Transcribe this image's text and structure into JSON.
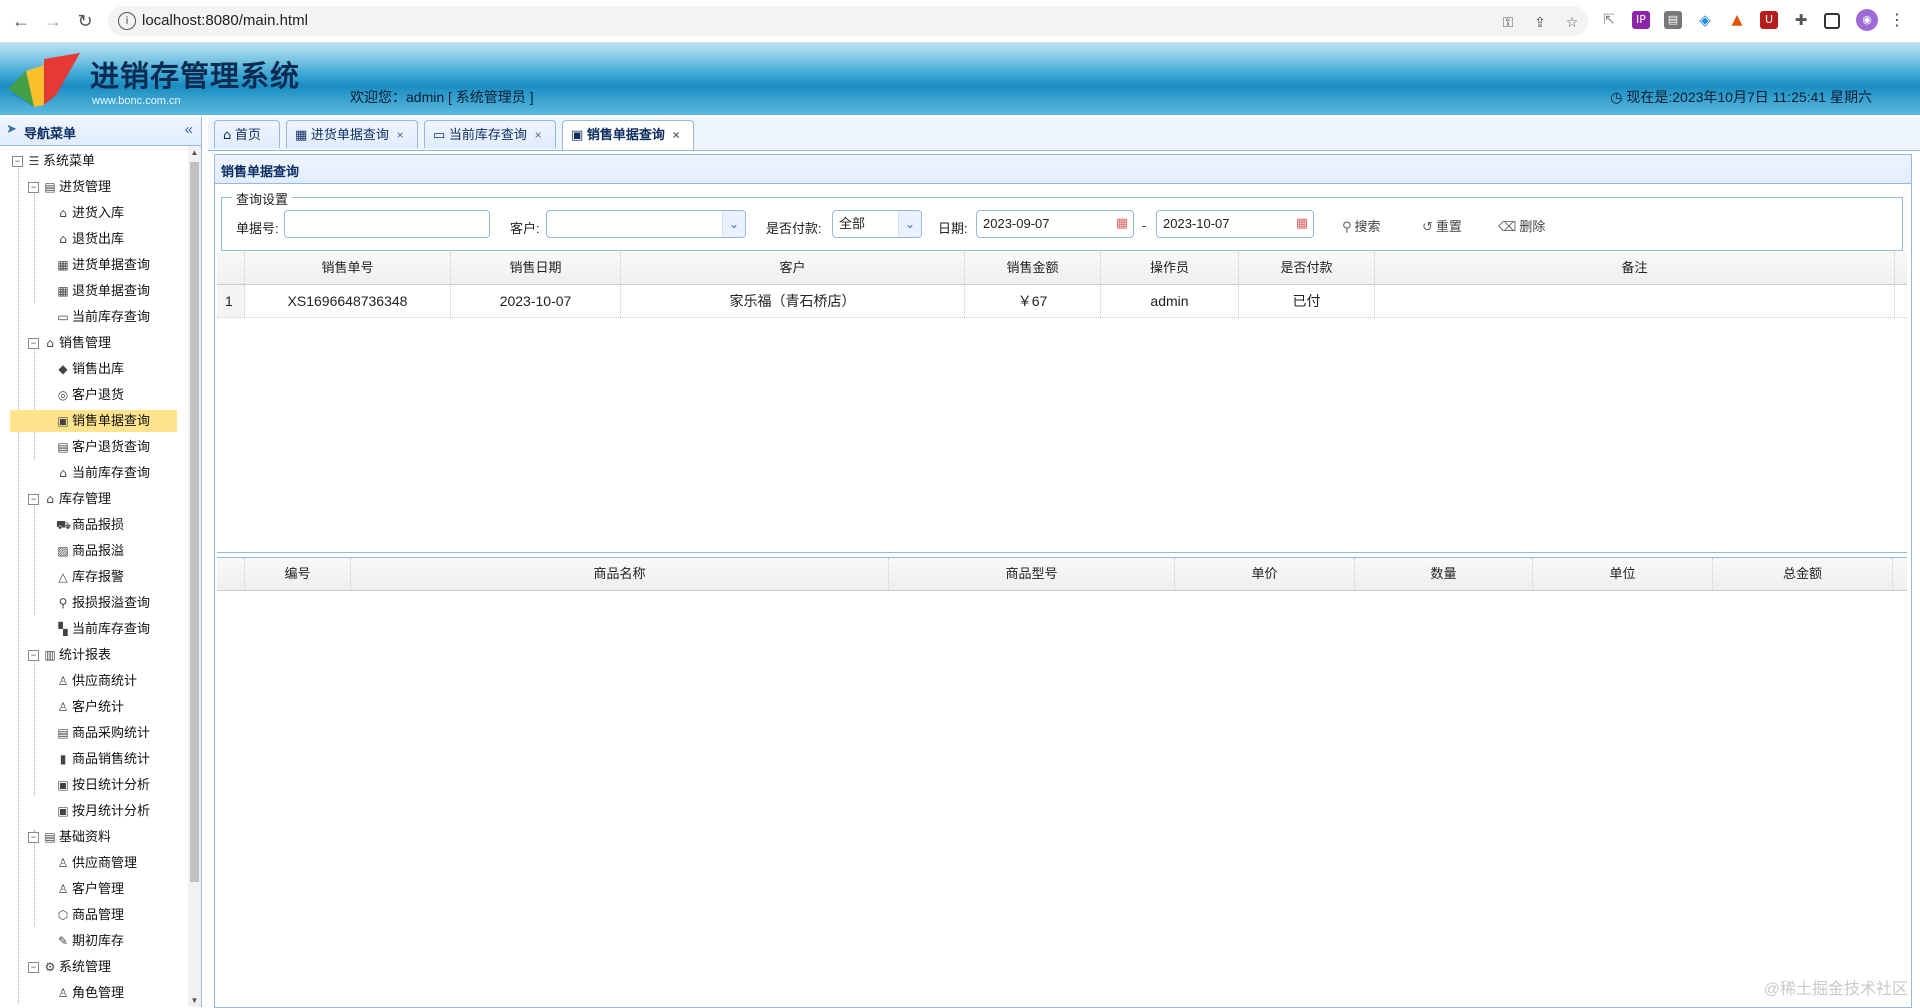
{
  "browser": {
    "url": "localhost:8080/main.html"
  },
  "header": {
    "title": "进销存管理系统",
    "subtitle": "www.bonc.com.cn",
    "welcome": "欢迎您：admin [ 系统管理员 ]",
    "clock": "现在是:2023年10月7日 11:25:41 星期六"
  },
  "sidebar": {
    "title": "导航菜单",
    "root": "系统菜单",
    "groups": [
      {
        "label": "进货管理",
        "items": [
          "进货入库",
          "退货出库",
          "进货单据查询",
          "退货单据查询",
          "当前库存查询"
        ]
      },
      {
        "label": "销售管理",
        "items": [
          "销售出库",
          "客户退货",
          "销售单据查询",
          "客户退货查询",
          "当前库存查询"
        ]
      },
      {
        "label": "库存管理",
        "items": [
          "商品报损",
          "商品报溢",
          "库存报警",
          "报损报溢查询",
          "当前库存查询"
        ]
      },
      {
        "label": "统计报表",
        "items": [
          "供应商统计",
          "客户统计",
          "商品采购统计",
          "商品销售统计",
          "按日统计分析",
          "按月统计分析"
        ]
      },
      {
        "label": "基础资料",
        "items": [
          "供应商管理",
          "客户管理",
          "商品管理",
          "期初库存"
        ]
      },
      {
        "label": "系统管理",
        "items": [
          "角色管理"
        ]
      }
    ]
  },
  "tabs": [
    {
      "label": "首页",
      "closable": false
    },
    {
      "label": "进货单据查询",
      "closable": true
    },
    {
      "label": "当前库存查询",
      "closable": true
    },
    {
      "label": "销售单据查询",
      "closable": true,
      "active": true
    }
  ],
  "tab_close": "×",
  "panel": {
    "title": "销售单据查询",
    "query_legend": "查询设置",
    "labels": {
      "bill_no": "单据号:",
      "customer": "客户:",
      "paid": "是否付款:",
      "date": "日期:",
      "date_sep": "-"
    },
    "fields": {
      "bill_no": "",
      "customer": "",
      "paid": "全部",
      "date_from": "2023-09-07",
      "date_to": "2023-10-07"
    },
    "buttons": {
      "search": "搜索",
      "reset": "重置",
      "delete": "删除"
    }
  },
  "bills": {
    "columns": [
      "销售单号",
      "销售日期",
      "客户",
      "销售金额",
      "操作员",
      "是否付款",
      "备注"
    ],
    "rows": [
      {
        "num": "1",
        "bill_no": "XS1696648736348",
        "date": "2023-10-07",
        "customer": "家乐福（青石桥店）",
        "amount": "￥67",
        "operator": "admin",
        "paid": "已付",
        "remark": ""
      }
    ]
  },
  "items": {
    "columns": [
      "编号",
      "商品名称",
      "商品型号",
      "单价",
      "数量",
      "单位",
      "总金额"
    ]
  },
  "watermark": "@稀土掘金技术社区"
}
